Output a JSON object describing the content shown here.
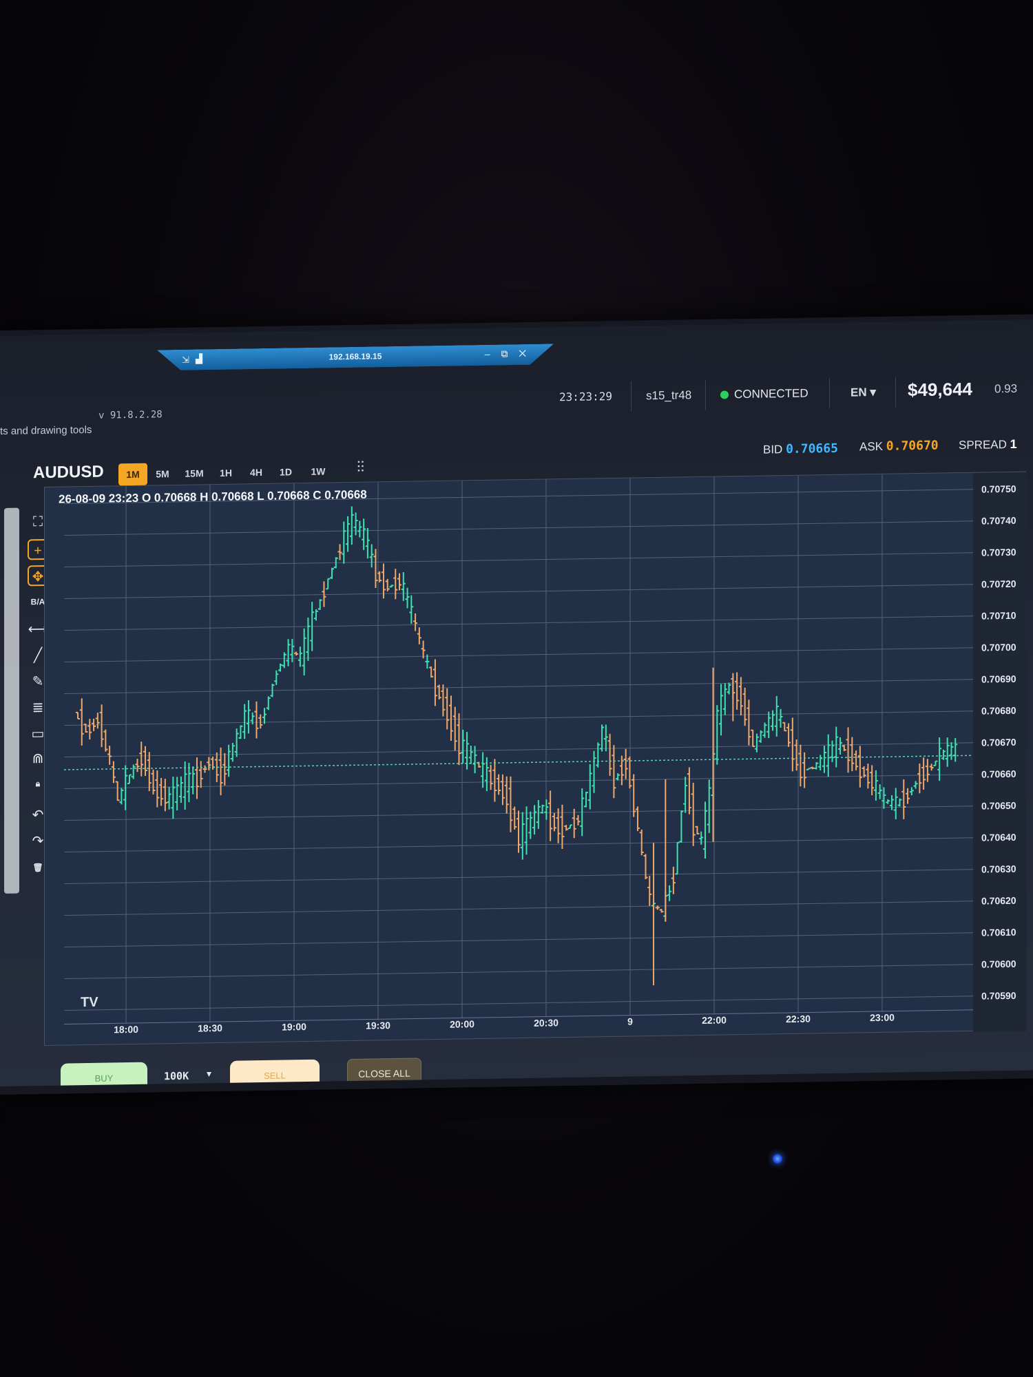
{
  "remote": {
    "host": "192.168.19.15",
    "pin_icon": "pin-icon",
    "signal_icon": "signal-icon",
    "window_controls": "– ⧉ ✕"
  },
  "header": {
    "hint": "ts and drawing tools",
    "version": "v 91.8.2.28",
    "clock": "23:23:29",
    "user": "s15_tr48",
    "status": "CONNECTED",
    "status_color": "#2ed158",
    "language": "EN ▾",
    "balance": "$49,644",
    "ratio": "0.93"
  },
  "symbol": "AUDUSD",
  "timeframes": [
    {
      "label": "1M",
      "active": true
    },
    {
      "label": "5M",
      "active": false
    },
    {
      "label": "15M",
      "active": false
    },
    {
      "label": "1H",
      "active": false
    },
    {
      "label": "4H",
      "active": false
    },
    {
      "label": "1D",
      "active": false
    },
    {
      "label": "1W",
      "active": false
    }
  ],
  "chart_type_icon": "candlestick-icon",
  "quote": {
    "bid_label": "BID",
    "bid": "0.70665",
    "ask_label": "ASK",
    "ask": "0.70670",
    "spread_label": "SPREAD",
    "spread": "1",
    "bid_color": "#3fb8ff",
    "ask_color": "#f5a623"
  },
  "tools": [
    {
      "name": "fullscreen-icon",
      "glyph": "⛶"
    },
    {
      "name": "crosshair-icon",
      "glyph": "+"
    },
    {
      "name": "move-icon",
      "glyph": "✥"
    },
    {
      "name": "ba-toggle",
      "glyph": "B/A"
    },
    {
      "name": "measure-icon",
      "glyph": "⟷"
    },
    {
      "name": "trendline-icon",
      "glyph": "╱"
    },
    {
      "name": "pencil-icon",
      "glyph": "✎"
    },
    {
      "name": "fib-levels-icon",
      "glyph": "≣"
    },
    {
      "name": "rectangle-icon",
      "glyph": "▭"
    },
    {
      "name": "magnet-icon",
      "glyph": "⋒"
    },
    {
      "name": "lock-icon",
      "glyph": "🔒︎"
    },
    {
      "name": "undo-icon",
      "glyph": "↶"
    },
    {
      "name": "redo-icon",
      "glyph": "↷"
    },
    {
      "name": "trash-icon",
      "glyph": "🗑︎"
    }
  ],
  "ohlc_text": "26-08-09 23:23 O 0.70668 H 0.70668 L 0.70668 C 0.70668",
  "tv_logo": "TV",
  "chart_data": {
    "type": "line",
    "x_ticks": [
      "18:00",
      "18:30",
      "19:00",
      "19:30",
      "20:00",
      "20:30",
      "9",
      "22:00",
      "22:30",
      "23:00"
    ],
    "y_ticks": [
      "0.70750",
      "0.70740",
      "0.70730",
      "0.70720",
      "0.70710",
      "0.70700",
      "0.70690",
      "0.70680",
      "0.70670",
      "0.70660",
      "0.70650",
      "0.70640",
      "0.70630",
      "0.70620",
      "0.70610",
      "0.70600",
      "0.70590"
    ],
    "ylim": [
      0.7059,
      0.7075
    ],
    "current_price": 0.70666,
    "up_color": "#3de2b0",
    "down_color": "#f0a86a",
    "grid": true,
    "price_series": [
      [
        0,
        0.70684
      ],
      [
        3,
        0.70678
      ],
      [
        6,
        0.70682
      ],
      [
        9,
        0.70668
      ],
      [
        11,
        0.70656
      ],
      [
        14,
        0.70664
      ],
      [
        17,
        0.7067
      ],
      [
        20,
        0.7066
      ],
      [
        24,
        0.70656
      ],
      [
        28,
        0.70661
      ],
      [
        31,
        0.70663
      ],
      [
        34,
        0.70668
      ],
      [
        37,
        0.70664
      ],
      [
        40,
        0.70672
      ],
      [
        43,
        0.70682
      ],
      [
        47,
        0.7068
      ],
      [
        51,
        0.70696
      ],
      [
        54,
        0.70703
      ],
      [
        57,
        0.707
      ],
      [
        60,
        0.70712
      ],
      [
        64,
        0.70725
      ],
      [
        67,
        0.70735
      ],
      [
        70,
        0.70743
      ],
      [
        73,
        0.70738
      ],
      [
        76,
        0.70726
      ],
      [
        79,
        0.70722
      ],
      [
        82,
        0.70724
      ],
      [
        85,
        0.70713
      ],
      [
        88,
        0.707
      ],
      [
        91,
        0.7069
      ],
      [
        94,
        0.70682
      ],
      [
        97,
        0.70672
      ],
      [
        100,
        0.70668
      ],
      [
        103,
        0.70663
      ],
      [
        106,
        0.7066
      ],
      [
        109,
        0.70655
      ],
      [
        112,
        0.70642
      ],
      [
        115,
        0.70647
      ],
      [
        118,
        0.70652
      ],
      [
        121,
        0.70646
      ],
      [
        124,
        0.70645
      ],
      [
        127,
        0.70648
      ],
      [
        130,
        0.7066
      ],
      [
        133,
        0.70676
      ],
      [
        136,
        0.7066
      ],
      [
        139,
        0.70666
      ],
      [
        142,
        0.70644
      ],
      [
        145,
        0.70621
      ],
      [
        148,
        0.70618
      ],
      [
        151,
        0.7063
      ],
      [
        154,
        0.7066
      ],
      [
        156,
        0.70645
      ],
      [
        158,
        0.7064
      ],
      [
        160,
        0.70655
      ],
      [
        162,
        0.7068
      ],
      [
        165,
        0.7069
      ],
      [
        168,
        0.70685
      ],
      [
        171,
        0.7067
      ],
      [
        174,
        0.70676
      ],
      [
        177,
        0.7068
      ],
      [
        180,
        0.70672
      ],
      [
        183,
        0.70662
      ],
      [
        186,
        0.70663
      ],
      [
        189,
        0.70666
      ],
      [
        192,
        0.7067
      ],
      [
        195,
        0.70668
      ],
      [
        198,
        0.70662
      ],
      [
        201,
        0.70658
      ],
      [
        204,
        0.70652
      ],
      [
        207,
        0.70651
      ],
      [
        210,
        0.70654
      ],
      [
        213,
        0.7066
      ],
      [
        216,
        0.70663
      ],
      [
        219,
        0.70667
      ],
      [
        222,
        0.70668
      ]
    ],
    "x_range": [
      0,
      222
    ]
  },
  "footer": {
    "buy_label": "BUY",
    "lot": "100K",
    "lot_caret": "▾",
    "sell_label": "SELL",
    "close_all_label": "CLOSE ALL",
    "buy_color": "#c8f1c0",
    "sell_color": "#fde9c8"
  }
}
